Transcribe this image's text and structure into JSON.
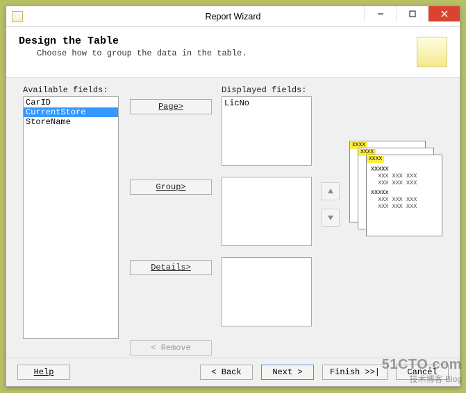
{
  "window": {
    "title": "Report Wizard"
  },
  "header": {
    "title": "Design the Table",
    "subtitle": "Choose how to group the data in the table."
  },
  "labels": {
    "available": "Available fields:",
    "displayed": "Displayed fields:"
  },
  "available_fields": [
    "CarID",
    "CurrentStore",
    "StoreName"
  ],
  "available_selected_index": 1,
  "displayed_fields": {
    "page": [
      "LicNo"
    ],
    "group": [],
    "details": []
  },
  "buttons": {
    "page": "Page>",
    "group": "Group>",
    "details": "Details>",
    "remove": "< Remove",
    "help": "Help",
    "back": "< Back",
    "next": "Next >",
    "finish": "Finish >>|",
    "cancel": "Cancel"
  },
  "preview_placeholder": "XXXX",
  "watermark": {
    "line1": "51CTO.com",
    "line2": "技术博客 Blog"
  }
}
